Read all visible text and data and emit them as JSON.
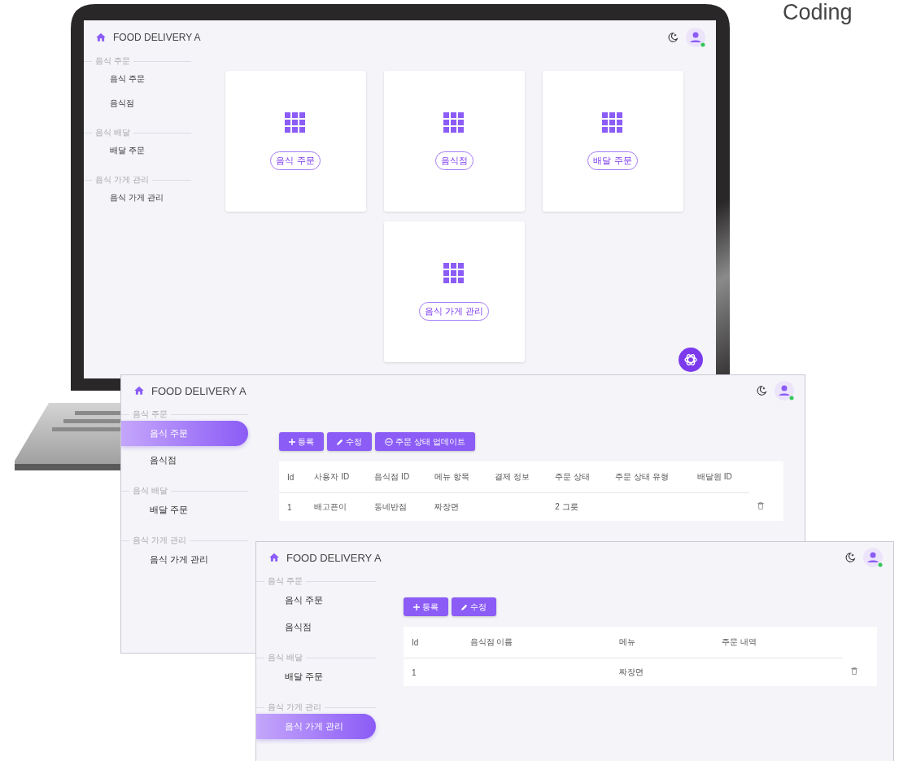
{
  "heading": "Coding",
  "screens": [
    {
      "kind": "cards",
      "title": "FOOD DELIVERY A",
      "sidebar": [
        {
          "group": "음식 주문",
          "items": [
            {
              "label": "음식 주문",
              "selected": false
            },
            {
              "label": "음식점",
              "selected": false
            }
          ]
        },
        {
          "group": "음식 배달",
          "items": [
            {
              "label": "배달 주문",
              "selected": false
            }
          ]
        },
        {
          "group": "음식 가게 관리",
          "items": [
            {
              "label": "음식 가게 관리",
              "selected": false
            }
          ]
        }
      ],
      "cards": [
        "음식 주문",
        "음식점",
        "배달 주문",
        "음식 가게 관리"
      ]
    },
    {
      "kind": "table",
      "title": "FOOD DELIVERY A",
      "sidebar": [
        {
          "group": "음식 주문",
          "items": [
            {
              "label": "음식 주문",
              "selected": true
            },
            {
              "label": "음식점",
              "selected": false
            }
          ]
        },
        {
          "group": "음식 배달",
          "items": [
            {
              "label": "배달 주문",
              "selected": false
            }
          ]
        },
        {
          "group": "음식 가게 관리",
          "items": [
            {
              "label": "음식 가게 관리",
              "selected": false
            }
          ]
        }
      ],
      "buttons": [
        {
          "kind": "add",
          "label": "등록"
        },
        {
          "kind": "edit",
          "label": "수정"
        },
        {
          "kind": "status",
          "label": "주문 상태 업데이트"
        }
      ],
      "table": {
        "columns": [
          "Id",
          "사용자 ID",
          "음식점 ID",
          "메뉴 항목",
          "결제 정보",
          "주문 상태",
          "주문 상태 유형",
          "배달원 ID"
        ],
        "rows": [
          [
            "1",
            "배고픈이",
            "동네반점",
            "짜장면",
            null,
            "2 그릇",
            null,
            null
          ]
        ]
      }
    },
    {
      "kind": "table",
      "title": "FOOD DELIVERY A",
      "sidebar": [
        {
          "group": "음식 주문",
          "items": [
            {
              "label": "음식 주문",
              "selected": false
            },
            {
              "label": "음식점",
              "selected": false
            }
          ]
        },
        {
          "group": "음식 배달",
          "items": [
            {
              "label": "배달 주문",
              "selected": false
            }
          ]
        },
        {
          "group": "음식 가게 관리",
          "items": [
            {
              "label": "음식 가게 관리",
              "selected": true
            }
          ]
        }
      ],
      "buttons": [
        {
          "kind": "add",
          "label": "등록"
        },
        {
          "kind": "edit",
          "label": "수정"
        }
      ],
      "table": {
        "columns": [
          "Id",
          "음식점 이름",
          "메뉴",
          "주문 내역"
        ],
        "rows": [
          [
            "1",
            null,
            "짜장면",
            null
          ]
        ]
      }
    }
  ]
}
